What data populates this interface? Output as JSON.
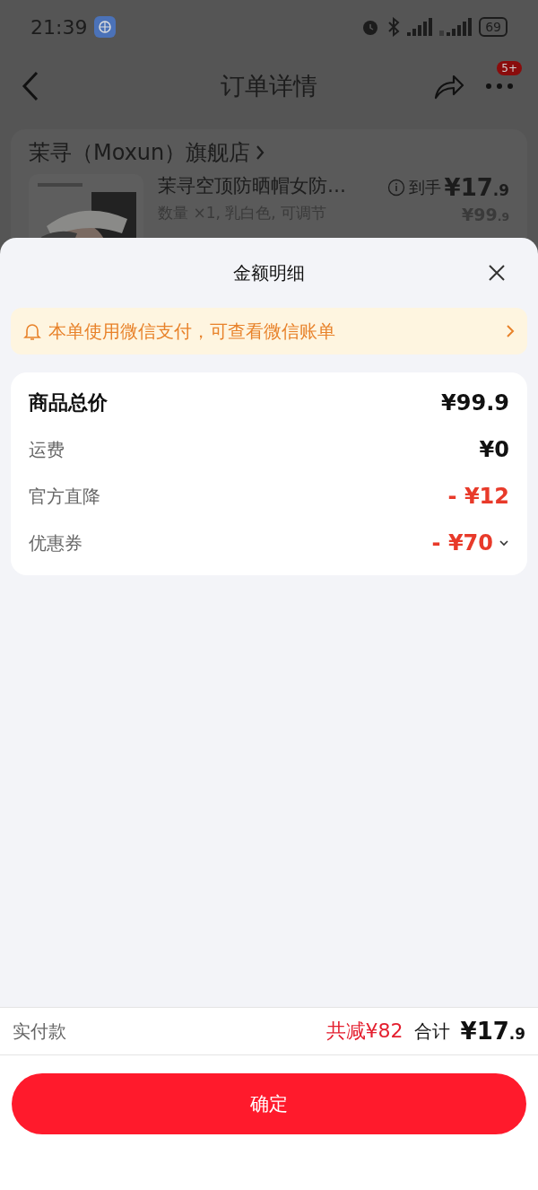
{
  "status_bar": {
    "time": "21:39",
    "battery": "69"
  },
  "header": {
    "title": "订单详情",
    "badge": "5+"
  },
  "order_card": {
    "store": "茉寻（Moxun）旗舰店",
    "product": {
      "kind": "picture",
      "title": "茉寻空顶防晒帽女防…",
      "specs": "数量 ×1, 乳白色, 可调节",
      "final_label": "到手",
      "final_price": {
        "main": "¥17",
        "decimal": ".9"
      },
      "original_price": {
        "main": "¥99",
        "decimal": ".9"
      }
    }
  },
  "sheet": {
    "title": "金额明细",
    "notice": "本单使用微信支付，可查看微信账单",
    "rows": [
      {
        "kind": "total",
        "label": "商品总价",
        "amount": "¥99.9"
      },
      {
        "kind": "fee",
        "label": "运费",
        "amount": "¥0"
      },
      {
        "kind": "discount",
        "label": "官方直降",
        "amount": "- ¥12"
      },
      {
        "kind": "discount",
        "label": "优惠券",
        "amount": "- ¥70",
        "expanded": false
      }
    ]
  },
  "footer": {
    "label": "实付款",
    "saved": "共减¥82",
    "total_label": "合计",
    "total": {
      "main": "¥17",
      "decimal": ".9"
    },
    "confirm": "确定"
  }
}
